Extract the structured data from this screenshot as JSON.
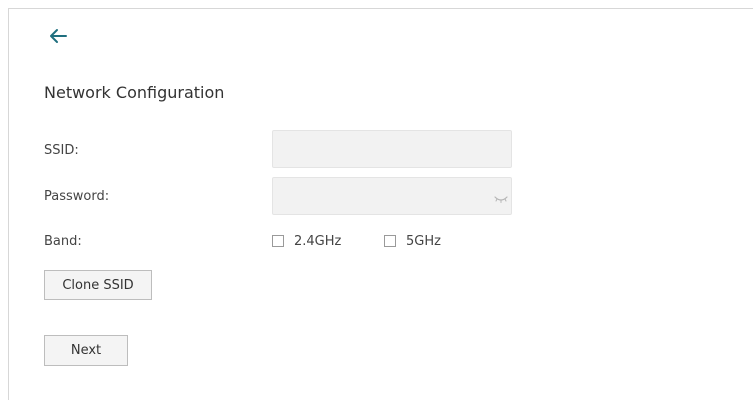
{
  "page": {
    "title": "Network Configuration",
    "back_icon": "arrow-left-icon"
  },
  "form": {
    "ssid_label": "SSID:",
    "ssid_value": "",
    "password_label": "Password:",
    "password_value": "",
    "password_toggle_icon": "eye-closed-icon",
    "band_label": "Band:",
    "band_options": [
      {
        "label": "2.4GHz",
        "checked": false
      },
      {
        "label": "5GHz",
        "checked": false
      }
    ]
  },
  "buttons": {
    "clone_ssid": "Clone SSID",
    "next": "Next"
  },
  "colors": {
    "accent": "#1f6f7f",
    "input_bg": "#f2f2f2",
    "button_bg": "#f4f4f4"
  }
}
